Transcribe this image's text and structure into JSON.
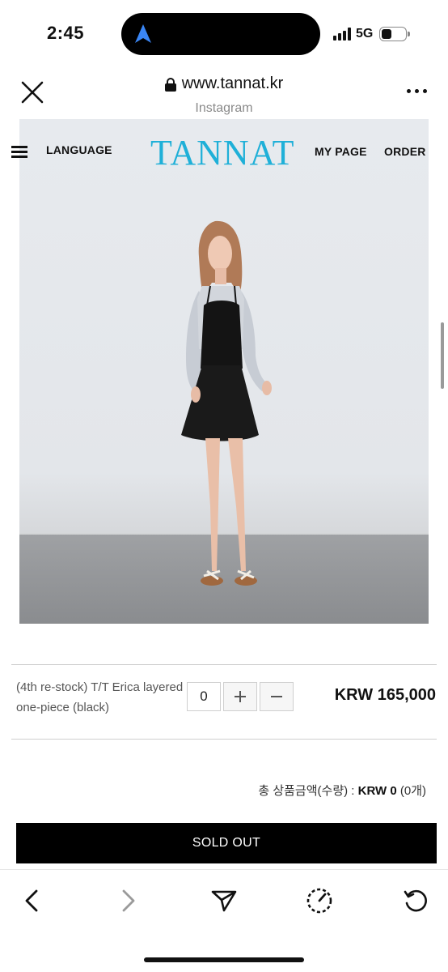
{
  "status_bar": {
    "time": "2:45",
    "network": "5G",
    "icons": [
      "signal-bars-icon",
      "battery-icon",
      "location-arrow-icon"
    ]
  },
  "browser": {
    "url": "www.tannat.kr",
    "source": "Instagram",
    "icons": [
      "close-icon",
      "lock-icon",
      "more-dots-icon"
    ]
  },
  "site_nav": {
    "language": "LANGUAGE",
    "brand": "TANNAT",
    "my_page": "MY PAGE",
    "order": "ORDER",
    "brand_color": "#1fb0d8"
  },
  "product": {
    "name": "(4th re-stock) T/T Erica layered one-piece (black)",
    "quantity": "0",
    "price": "KRW 165,000"
  },
  "total": {
    "label": "총 상품금액(수량) : ",
    "amount": "KRW 0",
    "count": "(0개)"
  },
  "buy_button": {
    "label": "SOLD OUT"
  },
  "toolbar": {
    "icons": [
      "back-arrow-icon",
      "forward-arrow-icon",
      "share-icon",
      "speed-gauge-icon",
      "reload-icon"
    ]
  }
}
